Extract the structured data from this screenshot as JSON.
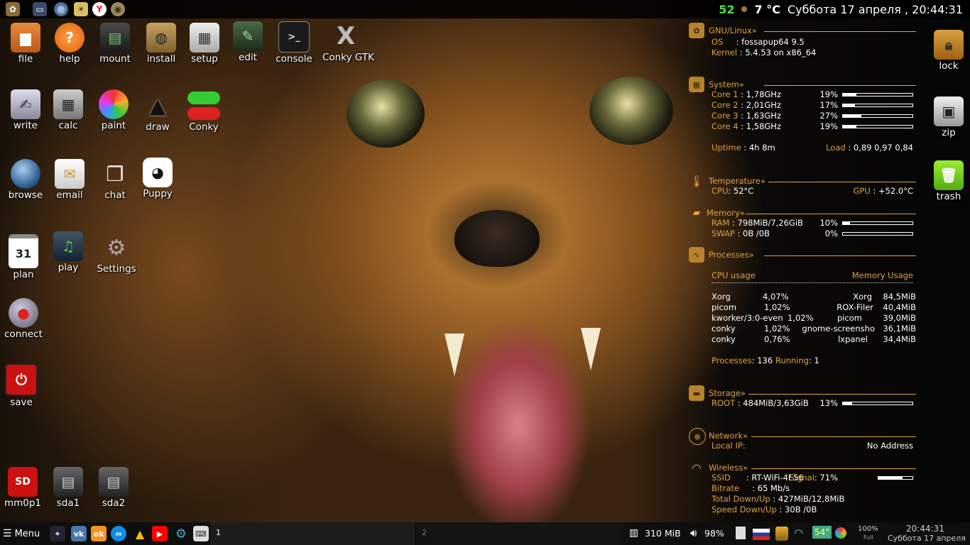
{
  "top_panel": {
    "launchers": [
      "puppy-menu-icon",
      "monitor-icon",
      "globe-icon",
      "weather-icon",
      "yandex-browser-icon",
      "turtle-icon"
    ],
    "cpu_temp": "52",
    "weather_temp": "7 °C",
    "datetime": "Суббота 17 апреля , 20:44:31"
  },
  "desktop_icons": [
    {
      "label": "file"
    },
    {
      "label": "help"
    },
    {
      "label": "mount"
    },
    {
      "label": "install"
    },
    {
      "label": "setup"
    },
    {
      "label": "edit"
    },
    {
      "label": "console"
    },
    {
      "label": "Conky GTK"
    },
    {
      "label": "write"
    },
    {
      "label": "calc"
    },
    {
      "label": "paint"
    },
    {
      "label": "draw"
    },
    {
      "label": "Conky"
    },
    {
      "label": "browse"
    },
    {
      "label": "email"
    },
    {
      "label": "chat"
    },
    {
      "label": "Puppy"
    },
    {
      "label": "plan"
    },
    {
      "label": "play"
    },
    {
      "label": "Settings"
    },
    {
      "label": "connect"
    },
    {
      "label": "save"
    },
    {
      "label": "mm0p1"
    },
    {
      "label": "sda1"
    },
    {
      "label": "sda2"
    }
  ],
  "plan_day": "31",
  "right_icons": [
    {
      "label": "lock"
    },
    {
      "label": "zip"
    },
    {
      "label": "trash"
    }
  ],
  "conky": {
    "gnu": {
      "title": "GNU/Linux»",
      "os_label": "OS",
      "os_value": ": fossapup64 9.5",
      "kernel_label": "Kernel",
      "kernel_value": ": 5.4.53 on x86_64"
    },
    "system": {
      "title": "System»",
      "cores": [
        {
          "label": "Core 1",
          "value": ": 1,78GHz",
          "pct": "19%",
          "frac": 0.19
        },
        {
          "label": "Core 2",
          "value": ": 2,01GHz",
          "pct": "17%",
          "frac": 0.17
        },
        {
          "label": "Core 3",
          "value": ": 1,63GHz",
          "pct": "27%",
          "frac": 0.27
        },
        {
          "label": "Core 4",
          "value": ": 1,58GHz",
          "pct": "19%",
          "frac": 0.19
        }
      ],
      "uptime_label": "Uptime",
      "uptime_value": ": 4h 8m",
      "load_label": "Load",
      "load_value": ": 0,89 0,97 0,84"
    },
    "temperature": {
      "title": "Temperature»",
      "cpu_label": "CPU",
      "cpu_value": ": 52°C",
      "gpu_label": "GPU",
      "gpu_value": ": +52.0°C"
    },
    "memory": {
      "title": "Memory»",
      "ram_label": "RAM",
      "ram_value": ": 798MiB/7,26GiB",
      "ram_pct": "10%",
      "ram_frac": 0.1,
      "swap_label": "SWAP",
      "swap_value": ": 0B  /0B",
      "swap_pct": "0%",
      "swap_frac": 0.0
    },
    "processes": {
      "title": "Processes»",
      "cpu_usage": "CPU usage",
      "mem_usage": "Memory Usage",
      "cpu_list": [
        [
          "Xorg",
          "4,07%"
        ],
        [
          "picom",
          "1,02%"
        ],
        [
          "kworker/3:0-even",
          "1,02%"
        ],
        [
          "conky",
          "1,02%"
        ],
        [
          "conky",
          "0,76%"
        ]
      ],
      "mem_list": [
        [
          "Xorg",
          "84,5MiB"
        ],
        [
          "ROX-Filer",
          "40,4MiB"
        ],
        [
          "picom",
          "39,0MiB"
        ],
        [
          "gnome-screensho",
          "36,1MiB"
        ],
        [
          "lxpanel",
          "34,4MiB"
        ]
      ],
      "summary_label": "Processes",
      "summary_value": ": 136",
      "running_label": "Running",
      "running_value": ": 1"
    },
    "storage": {
      "title": "Storage»",
      "root_label": "ROOT",
      "root_value": ": 484MiB/3,63GiB",
      "root_pct": "13%",
      "root_frac": 0.13
    },
    "network": {
      "title": "Network»",
      "localip_label": "Local IP",
      "localip_value": "No Address"
    },
    "wireless": {
      "title": "Wireless»",
      "ssid_label": "SSID",
      "ssid_value": ": RT-WiFi-4E56",
      "signal_label": "Signal",
      "signal_value": ": 71%",
      "signal_frac": 0.71,
      "bitrate_label": "Bitrate",
      "bitrate_value": ": 65 Mb/s",
      "total_label": "Total Down/Up",
      "total_value": ": 427MiB/12,8MiB",
      "speed_label": "Speed Down/Up",
      "speed_value": ": 30B  /0B"
    }
  },
  "taskbar": {
    "menu_label": "Menu",
    "workspace1": "1",
    "workspace2": "2",
    "mem": "310 MiB",
    "volume": "98%",
    "temp_badge": "54°",
    "battery_pct": "100%",
    "battery_state": "Full",
    "time": "20:44:31",
    "date": "Суббота 17 апреля",
    "colors": {
      "accent": "#e0a040",
      "green": "#4ade4a"
    }
  }
}
